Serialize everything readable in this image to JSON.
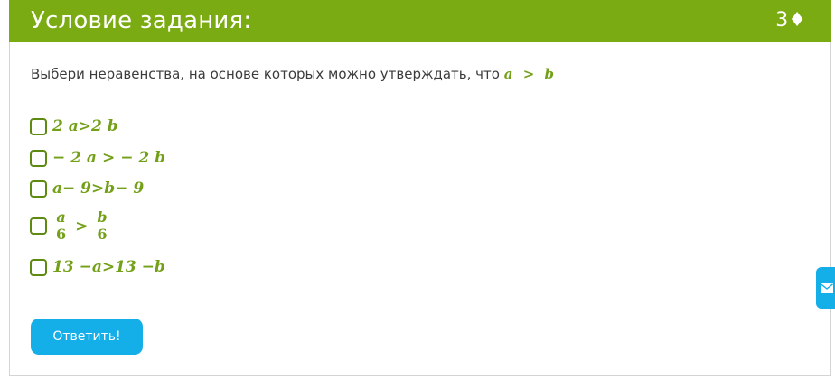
{
  "header": {
    "title": "Условие задания:",
    "points": "3♦"
  },
  "question": {
    "text": "Выбери неравенства, на основе которых можно утверждать, что",
    "math_a": "a",
    "math_gt": ">",
    "math_b": "b"
  },
  "options": [
    {
      "left": "2 a",
      "op": ">",
      "right": "2 b",
      "checked": false
    },
    {
      "left": "− 2 a",
      "op": ">",
      "right": "− 2 b",
      "checked": false
    },
    {
      "left": "a− 9",
      "op": ">",
      "right": "b− 9",
      "checked": false
    },
    {
      "num_left": "a",
      "den_left": "6",
      "op": ">",
      "num_right": "b",
      "den_right": "6",
      "checked": false
    },
    {
      "left": "13 −a",
      "op": ">",
      "right": "13 −b",
      "checked": false
    }
  ],
  "submit_label": "Ответить!",
  "side_tab_icon": "mail-icon",
  "colors": {
    "header_bg": "#7bab12",
    "math_green": "#73a018",
    "button_blue": "#14aee8"
  }
}
